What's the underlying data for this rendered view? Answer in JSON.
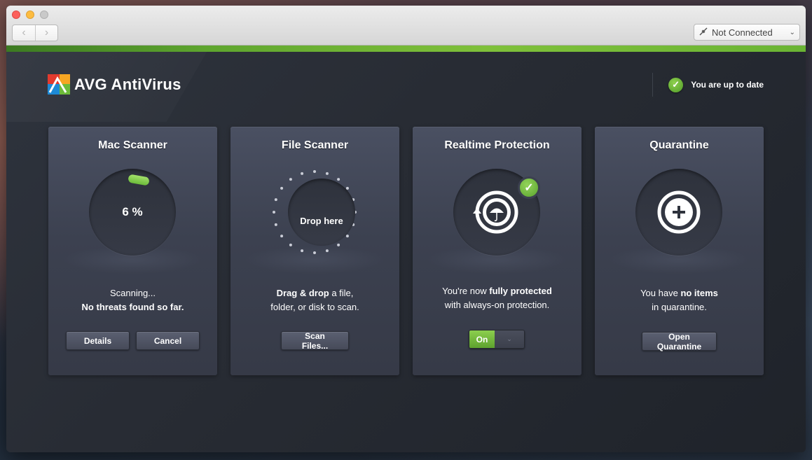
{
  "window": {
    "connection": {
      "value": "Not Connected",
      "icon": "plug-icon"
    },
    "nav": {
      "back_glyph": "‹",
      "forward_glyph": "›"
    }
  },
  "header": {
    "brand": "AVG AntiVirus",
    "status": "You are up to date",
    "status_color": "#6cbb3a"
  },
  "cards": {
    "mac_scanner": {
      "title": "Mac Scanner",
      "progress": "6 %",
      "progress_fraction": 0.06,
      "line1": "Scanning...",
      "line2": "No threats found so far.",
      "details_label": "Details",
      "cancel_label": "Cancel"
    },
    "file_scanner": {
      "title": "File Scanner",
      "drop_label": "Drop here",
      "line1_bold": "Drag & drop",
      "line1_rest": " a file,",
      "line2": "folder, or disk to scan.",
      "button_label": "Scan Files..."
    },
    "realtime": {
      "title": "Realtime Protection",
      "line1_pre": "You're now ",
      "line1_bold": "fully protected",
      "line2": "with always-on protection.",
      "toggle_label": "On",
      "toggle_state": "on"
    },
    "quarantine": {
      "title": "Quarantine",
      "line1_pre": "You have ",
      "line1_bold": "no items",
      "line2": "in quarantine.",
      "button_label": "Open Quarantine"
    }
  },
  "colors": {
    "accent_green": "#6cbb3a",
    "card_bg": "#3c4150",
    "app_bg": "#282c34"
  }
}
